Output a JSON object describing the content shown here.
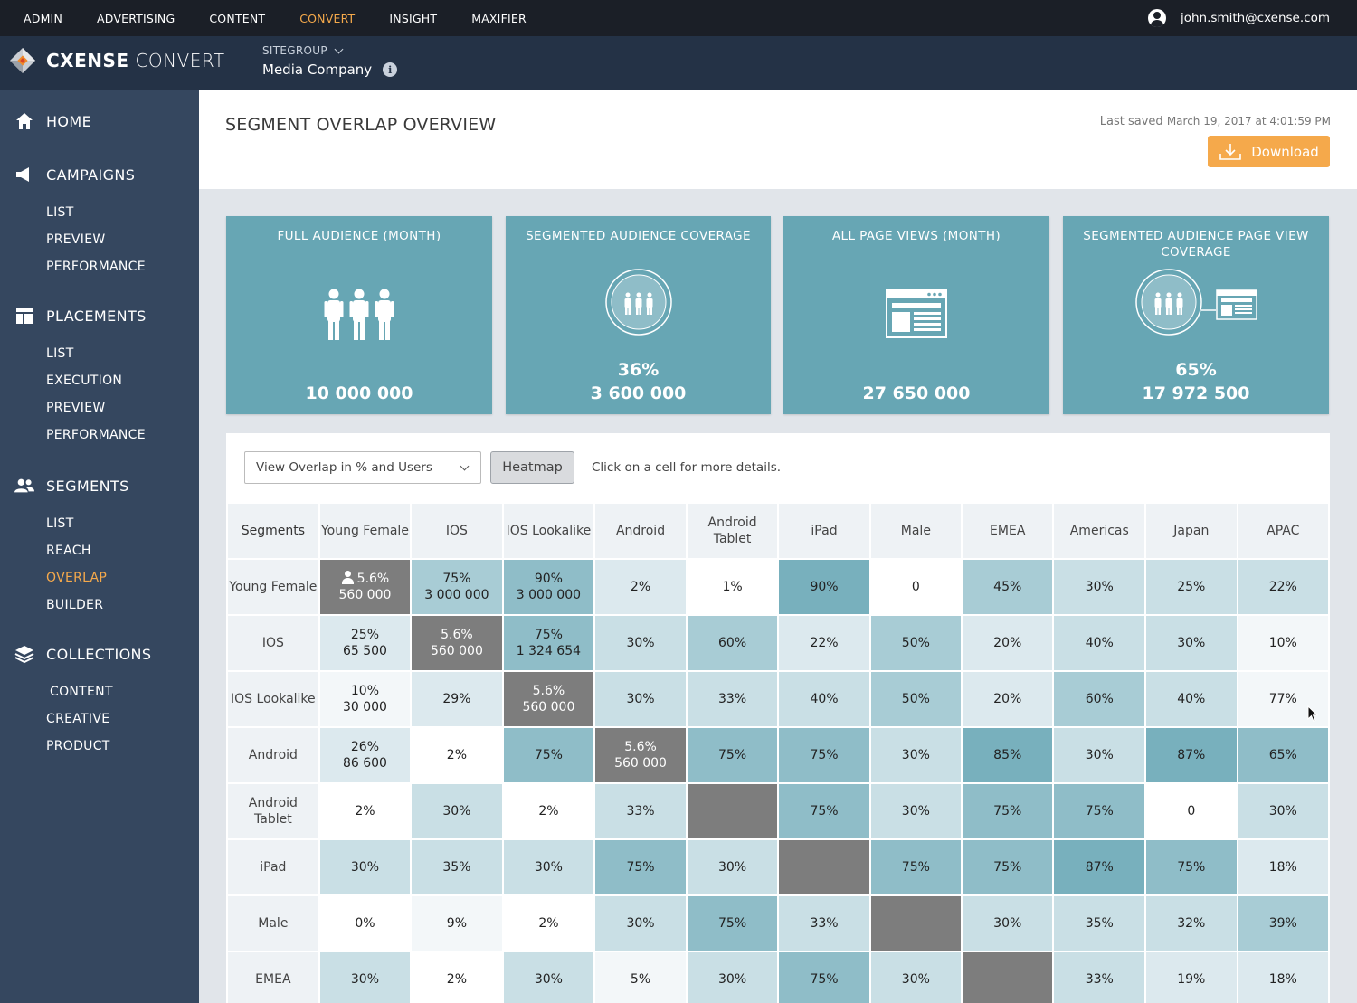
{
  "topnav": {
    "items": [
      "ADMIN",
      "ADVERTISING",
      "CONTENT",
      "CONVERT",
      "INSIGHT",
      "MAXIFIER"
    ],
    "active": "CONVERT",
    "user_email": "john.smith@cxense.com"
  },
  "brand": {
    "name_bold": "CXENSE",
    "name_light": "CONVERT",
    "sitegroup_label": "SITEGROUP",
    "sitegroup_value": "Media Company"
  },
  "sidebar": {
    "sections": [
      {
        "title": "HOME",
        "icon": "home-icon",
        "items": []
      },
      {
        "title": "CAMPAIGNS",
        "icon": "megaphone-icon",
        "items": [
          "LIST",
          "PREVIEW",
          "PERFORMANCE"
        ]
      },
      {
        "title": "PLACEMENTS",
        "icon": "layout-icon",
        "items": [
          "LIST",
          "EXECUTION",
          "PREVIEW",
          "PERFORMANCE"
        ]
      },
      {
        "title": "SEGMENTS",
        "icon": "users-icon",
        "items": [
          "LIST",
          "REACH",
          "OVERLAP",
          "BUILDER"
        ]
      },
      {
        "title": "COLLECTIONS",
        "icon": "layers-icon",
        "items": [
          "CONTENT",
          "CREATIVE",
          "PRODUCT"
        ]
      }
    ],
    "active_item": "OVERLAP"
  },
  "header": {
    "title": "SEGMENT OVERLAP OVERVIEW",
    "last_saved_label": "Last saved",
    "last_saved_value": "March 19, 2017 at 4:01:59 PM",
    "download_label": "Download"
  },
  "cards": [
    {
      "title": "FULL AUDIENCE (MONTH)",
      "icon": "audience-icon",
      "percent": "",
      "value": "10 000 000"
    },
    {
      "title": "SEGMENTED AUDIENCE COVERAGE",
      "icon": "segment-circle-icon",
      "percent": "36%",
      "value": "3 600 000"
    },
    {
      "title": "ALL PAGE VIEWS (MONTH)",
      "icon": "webpage-icon",
      "percent": "",
      "value": "27 650 000"
    },
    {
      "title": "SEGMENTED AUDIENCE PAGE VIEW COVERAGE",
      "icon": "segment-pageview-icon",
      "percent": "65%",
      "value": "17 972 500"
    }
  ],
  "controls": {
    "view_select": "View Overlap in % and Users",
    "heatmap_label": "Heatmap",
    "hint": "Click on a cell for more details."
  },
  "overlap": {
    "corner": "Segments",
    "columns": [
      "Young Female",
      "IOS",
      "IOS Lookalike",
      "Android",
      "Android Tablet",
      "iPad",
      "Male",
      "EMEA",
      "Americas",
      "Japan",
      "APAC"
    ],
    "rows": [
      {
        "label": "Young Female",
        "cells": [
          {
            "v": "5.6%",
            "u": "560 000",
            "self": true
          },
          {
            "v": "75%",
            "u": "3 000 000",
            "lvl": 4
          },
          {
            "v": "90%",
            "u": "3 000 000",
            "lvl": 5
          },
          {
            "v": "2%",
            "lvl": 2
          },
          {
            "v": "1%",
            "lvl": 0
          },
          {
            "v": "90%",
            "lvl": 6
          },
          {
            "v": "0",
            "lvl": 0
          },
          {
            "v": "45%",
            "lvl": 4
          },
          {
            "v": "30%",
            "lvl": 3
          },
          {
            "v": "25%",
            "lvl": 3
          },
          {
            "v": "22%",
            "lvl": 3
          }
        ]
      },
      {
        "label": "IOS",
        "cells": [
          {
            "v": "25%",
            "u": "65 500",
            "lvl": 2
          },
          {
            "v": "5.6%",
            "u": "560 000",
            "self": true
          },
          {
            "v": "75%",
            "u": "1 324 654",
            "lvl": 5
          },
          {
            "v": "30%",
            "lvl": 3
          },
          {
            "v": "60%",
            "lvl": 4
          },
          {
            "v": "22%",
            "lvl": 2
          },
          {
            "v": "50%",
            "lvl": 4
          },
          {
            "v": "20%",
            "lvl": 2
          },
          {
            "v": "40%",
            "lvl": 3
          },
          {
            "v": "30%",
            "lvl": 3
          },
          {
            "v": "10%",
            "lvl": 1
          }
        ]
      },
      {
        "label": "IOS Lookalike",
        "cells": [
          {
            "v": "10%",
            "u": "30 000",
            "lvl": 1
          },
          {
            "v": "29%",
            "lvl": 2
          },
          {
            "v": "5.6%",
            "u": "560 000",
            "self": true
          },
          {
            "v": "30%",
            "lvl": 3
          },
          {
            "v": "33%",
            "lvl": 3
          },
          {
            "v": "40%",
            "lvl": 3
          },
          {
            "v": "50%",
            "lvl": 4
          },
          {
            "v": "20%",
            "lvl": 2
          },
          {
            "v": "60%",
            "lvl": 4
          },
          {
            "v": "40%",
            "lvl": 3
          },
          {
            "v": "77%",
            "lvl": 1
          }
        ]
      },
      {
        "label": "Android",
        "cells": [
          {
            "v": "26%",
            "u": "86 600",
            "lvl": 2
          },
          {
            "v": "2%",
            "lvl": 0
          },
          {
            "v": "75%",
            "lvl": 5
          },
          {
            "v": "5.6%",
            "u": "560 000",
            "self": true
          },
          {
            "v": "75%",
            "lvl": 5
          },
          {
            "v": "75%",
            "lvl": 5
          },
          {
            "v": "30%",
            "lvl": 3
          },
          {
            "v": "85%",
            "lvl": 6
          },
          {
            "v": "30%",
            "lvl": 3
          },
          {
            "v": "87%",
            "lvl": 6
          },
          {
            "v": "65%",
            "lvl": 5
          }
        ]
      },
      {
        "label": "Android Tablet",
        "cells": [
          {
            "v": "2%",
            "lvl": 0
          },
          {
            "v": "30%",
            "lvl": 3
          },
          {
            "v": "2%",
            "lvl": 0
          },
          {
            "v": "33%",
            "lvl": 3
          },
          {
            "v": "",
            "self": true
          },
          {
            "v": "75%",
            "lvl": 5
          },
          {
            "v": "30%",
            "lvl": 3
          },
          {
            "v": "75%",
            "lvl": 5
          },
          {
            "v": "75%",
            "lvl": 5
          },
          {
            "v": "0",
            "lvl": 0
          },
          {
            "v": "30%",
            "lvl": 3
          }
        ]
      },
      {
        "label": "iPad",
        "cells": [
          {
            "v": "30%",
            "lvl": 3
          },
          {
            "v": "35%",
            "lvl": 3
          },
          {
            "v": "30%",
            "lvl": 3
          },
          {
            "v": "75%",
            "lvl": 5
          },
          {
            "v": "30%",
            "lvl": 3
          },
          {
            "v": "",
            "self": true
          },
          {
            "v": "75%",
            "lvl": 5
          },
          {
            "v": "75%",
            "lvl": 5
          },
          {
            "v": "87%",
            "lvl": 6
          },
          {
            "v": "75%",
            "lvl": 5
          },
          {
            "v": "18%",
            "lvl": 2
          }
        ]
      },
      {
        "label": "Male",
        "cells": [
          {
            "v": "0%",
            "lvl": 0
          },
          {
            "v": "9%",
            "lvl": 1
          },
          {
            "v": "2%",
            "lvl": 0
          },
          {
            "v": "30%",
            "lvl": 3
          },
          {
            "v": "75%",
            "lvl": 5
          },
          {
            "v": "33%",
            "lvl": 3
          },
          {
            "v": "",
            "self": true
          },
          {
            "v": "30%",
            "lvl": 3
          },
          {
            "v": "35%",
            "lvl": 3
          },
          {
            "v": "32%",
            "lvl": 3
          },
          {
            "v": "39%",
            "lvl": 4
          }
        ]
      },
      {
        "label": "EMEA",
        "cells": [
          {
            "v": "30%",
            "lvl": 3
          },
          {
            "v": "2%",
            "lvl": 0
          },
          {
            "v": "30%",
            "lvl": 3
          },
          {
            "v": "5%",
            "lvl": 1
          },
          {
            "v": "30%",
            "lvl": 3
          },
          {
            "v": "75%",
            "lvl": 5
          },
          {
            "v": "30%",
            "lvl": 3
          },
          {
            "v": "",
            "self": true
          },
          {
            "v": "33%",
            "lvl": 3
          },
          {
            "v": "19%",
            "lvl": 2
          },
          {
            "v": "18%",
            "lvl": 2
          }
        ]
      }
    ]
  },
  "colors": {
    "accent": "#f5a94b",
    "card": "#67a6b4",
    "sidebar": "#35475f",
    "self_cell": "#7d7d7d"
  }
}
